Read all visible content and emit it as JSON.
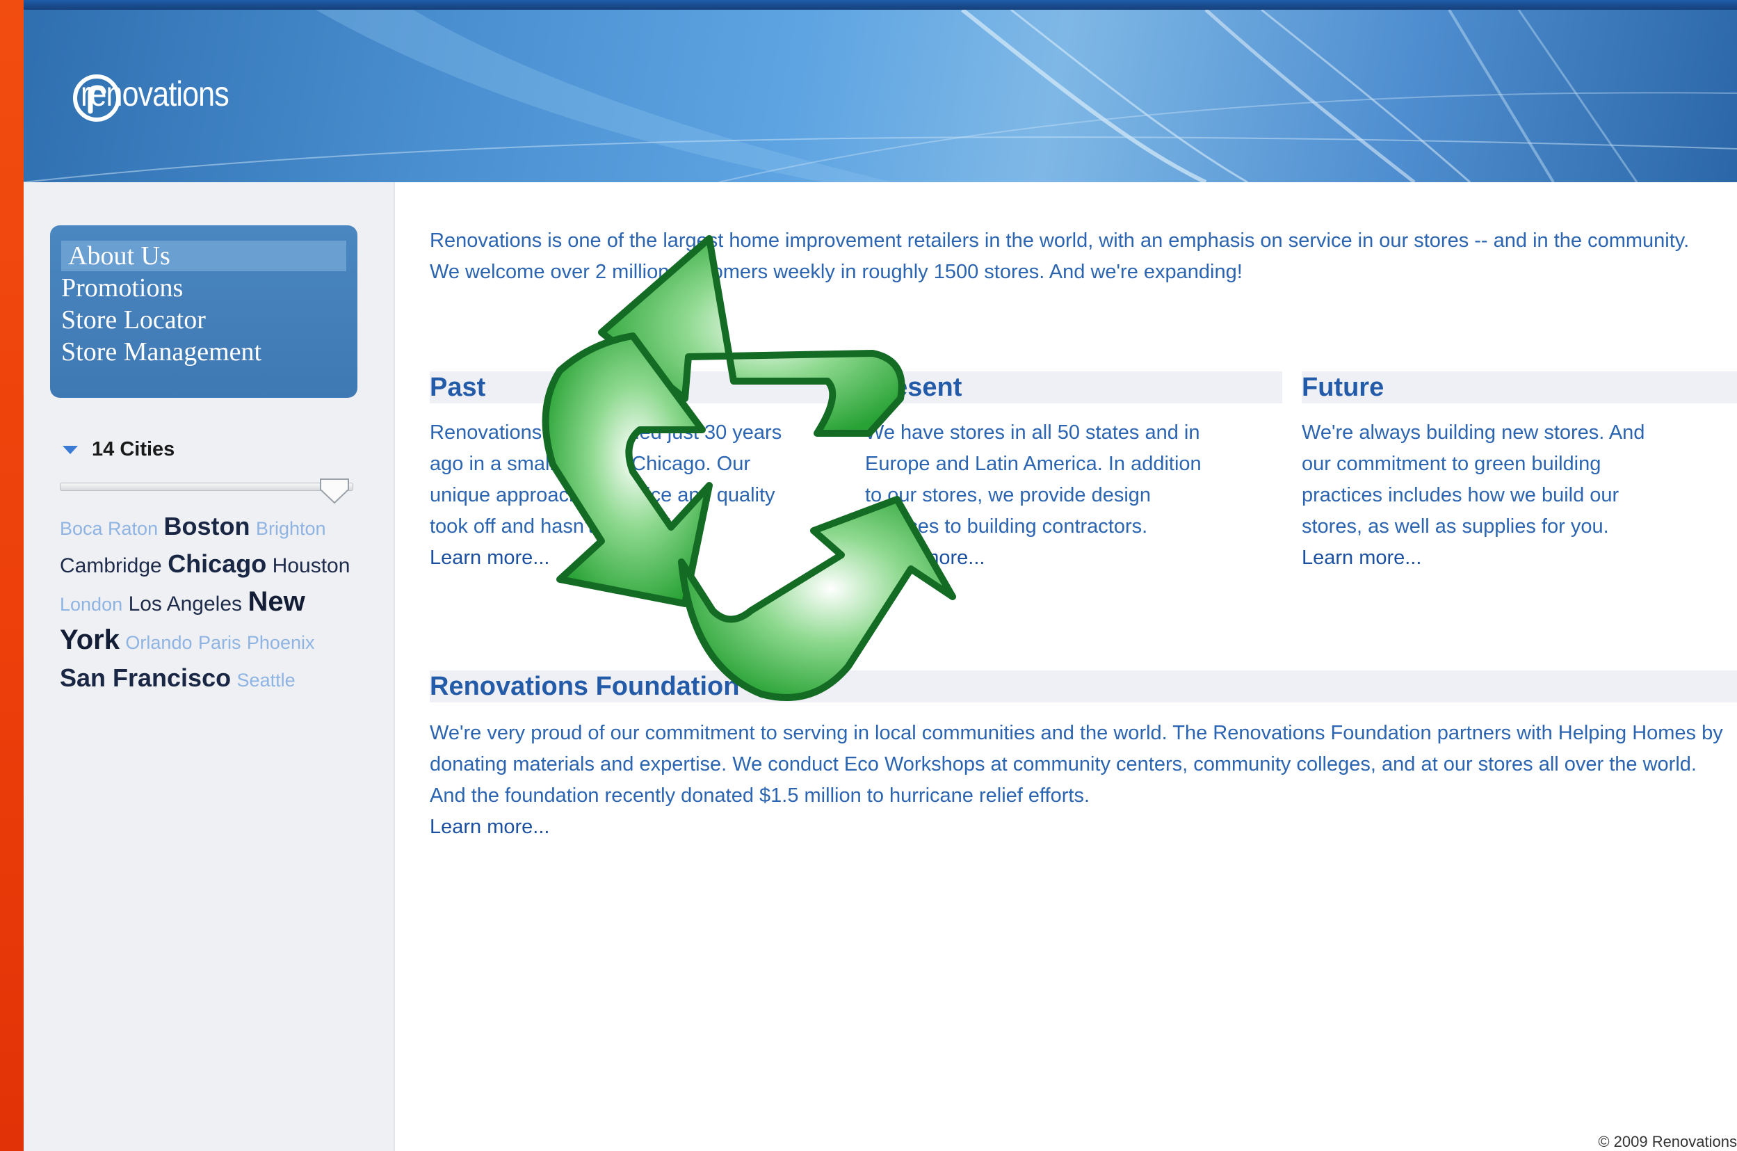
{
  "header": {
    "logo_text": "renovations",
    "logo_icon": "r-circle-logo-icon"
  },
  "nav": {
    "items": [
      {
        "label": "About Us"
      },
      {
        "label": "Promotions"
      },
      {
        "label": "Store Locator"
      },
      {
        "label": "Store Management"
      }
    ]
  },
  "cities": {
    "heading": "14 Cities",
    "slider_value": 1.0,
    "tags": [
      {
        "name": "Boca Raton",
        "size": "s"
      },
      {
        "name": "Boston",
        "size": "l"
      },
      {
        "name": "Brighton",
        "size": "s"
      },
      {
        "name": "Cambridge",
        "size": "m"
      },
      {
        "name": "Chicago",
        "size": "l"
      },
      {
        "name": "Houston",
        "size": "m"
      },
      {
        "name": "London",
        "size": "s"
      },
      {
        "name": "Los Angeles",
        "size": "m"
      },
      {
        "name": "New York",
        "size": "xl"
      },
      {
        "name": "Orlando",
        "size": "s"
      },
      {
        "name": "Paris",
        "size": "s"
      },
      {
        "name": "Phoenix",
        "size": "s"
      },
      {
        "name": "San Francisco",
        "size": "l"
      },
      {
        "name": "Seattle",
        "size": "s"
      }
    ]
  },
  "intro": {
    "line1": "Renovations is one of the largest home improvement retailers in the world, with an emphasis on service in our stores -- and in the community.",
    "line2": "We welcome over 2 million customers weekly in roughly 1500 stores. And we're expanding!"
  },
  "sections": {
    "past": {
      "title": "Past",
      "text": "Renovations was founded just 30 years ago in a small store in Chicago. Our unique approach to service and quality took off and hasn't stopped.",
      "link": "Learn more..."
    },
    "present": {
      "title": "Present",
      "text": "We have stores in all 50 states and in Europe and Latin America. In addition to our stores, we provide design services to building contractors.",
      "link": "Learn more..."
    },
    "future": {
      "title": "Future",
      "text": "We're always building new stores. And our commitment to green building practices includes how we build our stores, as well as supplies for you.",
      "link": "Learn more..."
    }
  },
  "foundation": {
    "title": "Renovations Foundation",
    "text": "We're very proud of our commitment to serving in local communities and the world. The Renovations Foundation partners with Helping Homes by donating materials and expertise. We conduct Eco Workshops at community centers, community colleges, and at our stores all over the world. And the foundation recently donated $1.5 million to hurricane relief efforts.",
    "link": "Learn more..."
  },
  "footer": {
    "text": "© 2009 Renovations"
  },
  "overlay": {
    "icon": "recycle-arrows-icon"
  },
  "colors": {
    "accent": "#2b64b0",
    "nav_bg": "#4682bd",
    "recycle_green": "#2ea83a",
    "side_orange": "#ec3e0a"
  }
}
